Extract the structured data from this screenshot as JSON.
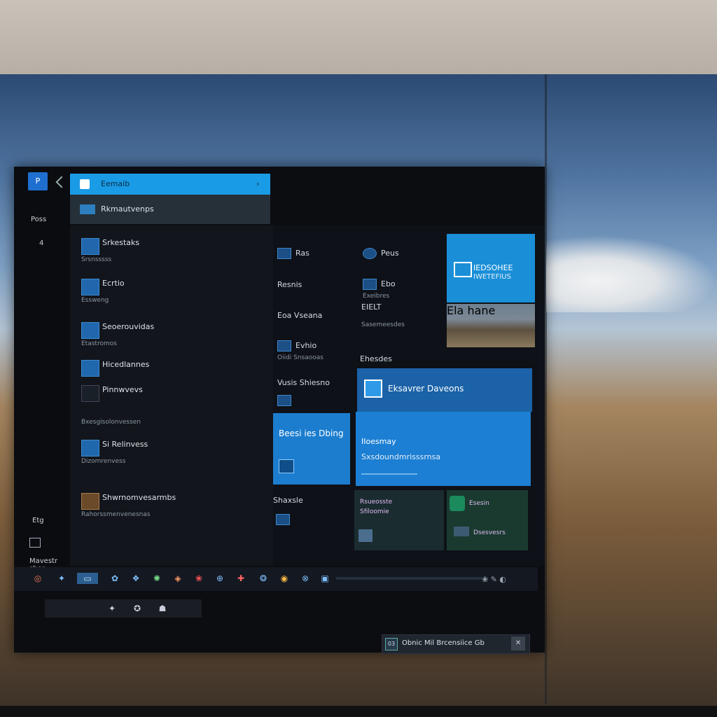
{
  "window": {
    "logo": "P"
  },
  "rail": {
    "top_label": "Poss",
    "sub_label": "4",
    "bottom_a": "Etg",
    "bottom_b": "Mavestr sbor"
  },
  "header": {
    "title": "Eemaib",
    "chevron": "›"
  },
  "subheader": {
    "label": "Rkmautvenps"
  },
  "list": [
    {
      "title": "Srkestaks",
      "sub": "Srsnsssss"
    },
    {
      "title": "Ecrtio",
      "sub": "Essweng"
    },
    {
      "title": "Seoerouvidas",
      "sub": "Etastromos"
    },
    {
      "title": "Hicedlannes",
      "sub": ""
    },
    {
      "title": "Pinnwvevs",
      "sub": "Bxesgisolonvessen"
    },
    {
      "title": "Si Relinvess",
      "sub": "Dizomrenvess"
    },
    {
      "title": "Shwrnomvesarmbs",
      "sub": "Rahorssmenvenesnas"
    }
  ],
  "right_col1": [
    {
      "title": "Ras",
      "sub": ""
    },
    {
      "title": "Resnis",
      "sub": ""
    },
    {
      "title": "Eoa Vseana",
      "sub": ""
    },
    {
      "title": "Evhio",
      "sub": "Oiidi Snsaooas"
    },
    {
      "title": "Vusis Shiesno",
      "sub": ""
    },
    {
      "title": "Shaxsle",
      "sub": ""
    }
  ],
  "right_col2": [
    {
      "title": "Peus",
      "sub": ""
    },
    {
      "title": "Ebo",
      "sub": "Exeibres"
    },
    {
      "title": "EIELT",
      "sub": "Sasemeesdes"
    },
    {
      "title": "Ehesdes",
      "sub": ""
    }
  ],
  "tiles": {
    "t1_title": "IEDSOHEE",
    "t1_sub": "IWETEFIUS",
    "t2_title": "Eksavrer Daveons",
    "t3_title": "Beesi ies Dbing",
    "t4_title": "IIoesmay",
    "t4_sub": "Sxsdoundmrisssrnsa",
    "t5_title": "Rsueosste",
    "t5_sub": "Sfiloomie",
    "t6_title": "Esesin",
    "t6_sub": "Dsesvesrs",
    "landscape_caption": "Ela hane"
  },
  "taskbar": {
    "icons": [
      "◎",
      "✦",
      "▭",
      "✿",
      "❖",
      "✺",
      "◈",
      "❀",
      "⊕",
      "✚",
      "❂",
      "◉",
      "⊗",
      "▣"
    ],
    "tray": "❀ ✎ ◐"
  },
  "subtaskbar": {
    "icons": [
      "✦",
      "✪",
      "☗"
    ]
  },
  "notification": {
    "icon": "03",
    "text": "Obnic Mil Brcensiice Gb",
    "close": "✕"
  },
  "colors": {
    "accent": "#1a9be6",
    "tile_blue": "#1b72c2",
    "tile_dark": "#1d2b34"
  }
}
